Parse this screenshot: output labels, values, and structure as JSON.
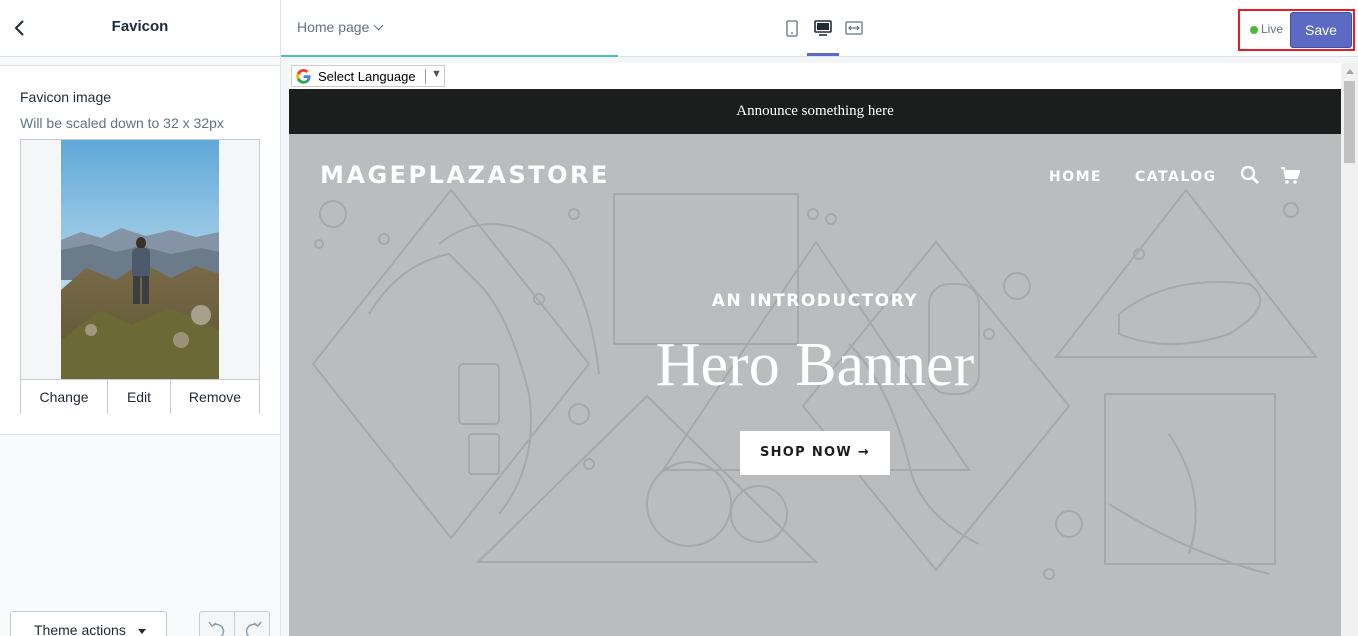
{
  "sidebar": {
    "title": "Favicon",
    "back_icon": "chevron-left-icon",
    "favicon": {
      "label": "Favicon image",
      "help_text": "Will be scaled down to 32 x 32px",
      "actions": {
        "change": "Change",
        "edit": "Edit",
        "remove": "Remove"
      }
    },
    "footer": {
      "theme_actions": "Theme actions",
      "undo_icon": "undo-icon",
      "redo_icon": "redo-icon"
    }
  },
  "topbar": {
    "page_selector": "Home page",
    "devices": [
      "mobile-icon",
      "desktop-icon",
      "fullscreen-icon"
    ],
    "active_device": "desktop",
    "status": "Live",
    "status_color": "#50b83c",
    "save_label": "Save",
    "accent": "#5c6ac4"
  },
  "preview": {
    "language_selector": "Select Language",
    "announcement": "Announce something here",
    "store_name": "MAGEPLAZASTORE",
    "nav": {
      "home": "HOME",
      "catalog": "CATALOG",
      "search_icon": "search-icon",
      "cart_icon": "cart-icon"
    },
    "hero": {
      "kicker": "AN INTRODUCTORY",
      "title": "Hero Banner",
      "button": "SHOP NOW →"
    }
  }
}
